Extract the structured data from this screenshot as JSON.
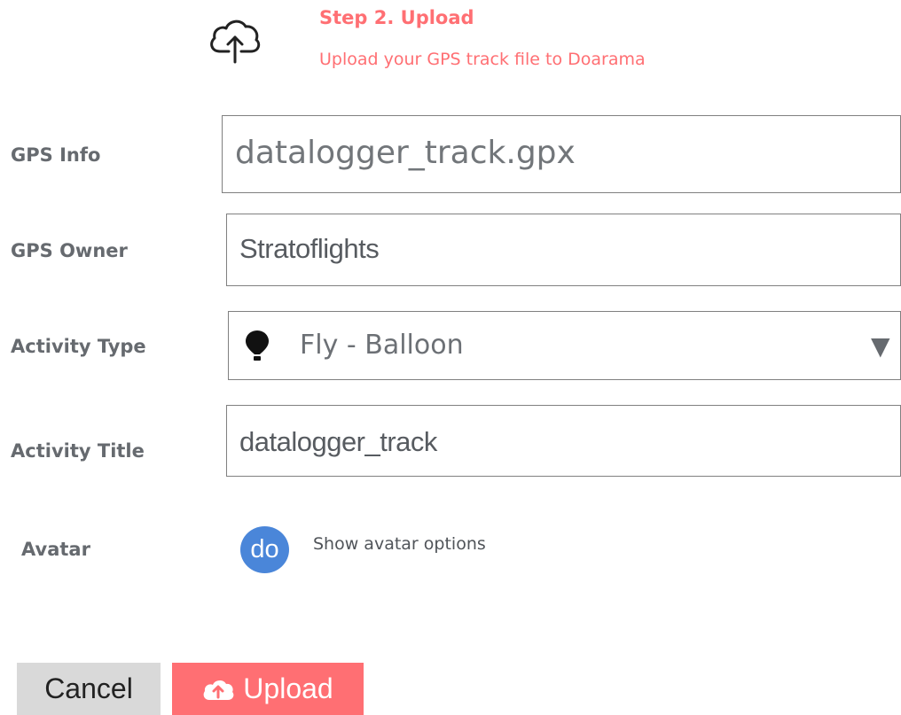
{
  "header": {
    "step_title": "Step 2. Upload",
    "step_subtitle": "Upload your GPS track file to Doarama",
    "icon": "cloud-upload-icon",
    "accent_color": "#ff6f73"
  },
  "form": {
    "gps_info": {
      "label": "GPS Info",
      "value": "datalogger_track.gpx"
    },
    "gps_owner": {
      "label": "GPS Owner",
      "value": "Stratoflights"
    },
    "activity_type": {
      "label": "Activity Type",
      "selected": "Fly - Balloon",
      "icon": "balloon-icon",
      "arrow": "▼"
    },
    "activity_title": {
      "label": "Activity Title",
      "value": "datalogger_track"
    },
    "avatar": {
      "label": "Avatar",
      "initials": "do",
      "link": "Show avatar options",
      "color": "#4a86d9"
    }
  },
  "actions": {
    "cancel_label": "Cancel",
    "upload_label": "Upload",
    "upload_icon": "cloud-upload-icon"
  }
}
